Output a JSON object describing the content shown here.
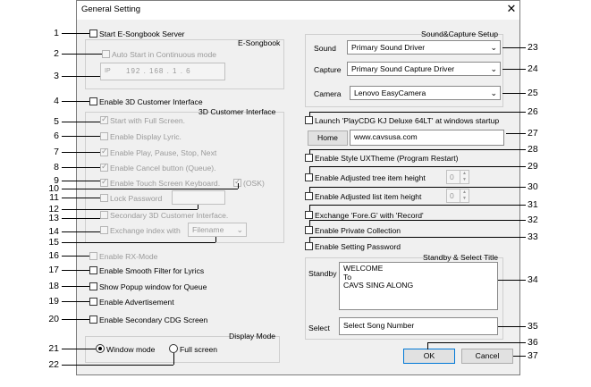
{
  "window": {
    "title": "General Setting",
    "close_glyph": "✕"
  },
  "callouts": [
    "1",
    "2",
    "3",
    "4",
    "5",
    "6",
    "7",
    "8",
    "9",
    "10",
    "11",
    "12",
    "13",
    "14",
    "15",
    "16",
    "17",
    "18",
    "19",
    "20",
    "21",
    "22",
    "23",
    "24",
    "25",
    "26",
    "27",
    "28",
    "29",
    "30",
    "31",
    "32",
    "33",
    "34",
    "35",
    "36",
    "37"
  ],
  "esongbook": {
    "group_title": "E-Songbook",
    "start_server": {
      "label": "Start E-Songbook Server",
      "checked": false
    },
    "auto_start": {
      "label": "Auto Start in Continuous mode",
      "checked": false
    },
    "ip_prefix": "IP",
    "ip_value": "192 . 168 . 1 . 6"
  },
  "enable3d": {
    "label": "Enable 3D Customer Interface",
    "checked": false
  },
  "customer3d": {
    "group_title": "3D Customer Interface",
    "full_screen": {
      "label": "Start with Full Screen.",
      "checked": true
    },
    "display_lyric": {
      "label": "Enable Display Lyric.",
      "checked": false
    },
    "play_pause": {
      "label": "Enable Play, Pause, Stop, Next",
      "checked": true
    },
    "cancel_button": {
      "label": "Enable Cancel button (Queue).",
      "checked": true
    },
    "touch_keyboard": {
      "label": "Enable Touch Screen Keyboard.",
      "checked": true
    },
    "osk": {
      "label": "(OSK)",
      "checked": true
    },
    "lock_password": {
      "label": "Lock Password",
      "checked": false
    },
    "secondary_3d": {
      "label": "Secondary 3D Customer Interface.",
      "checked": false
    },
    "exchange_index": {
      "label": "Exchange index with",
      "checked": false,
      "value": "Filename"
    }
  },
  "left_options": {
    "rx_mode": {
      "label": "Enable RX-Mode",
      "checked": false
    },
    "smooth_filter": {
      "label": "Enable Smooth Filter for Lyrics",
      "checked": false
    },
    "popup_queue": {
      "label": "Show Popup window for Queue",
      "checked": false
    },
    "advertisement": {
      "label": "Enable Advertisement",
      "checked": false
    },
    "secondary_cdg": {
      "label": "Enable Secondary CDG Screen",
      "checked": false
    }
  },
  "display_mode": {
    "group_title": "Display Mode",
    "window_mode": {
      "label": "Window mode",
      "selected": true
    },
    "full_screen": {
      "label": "Full screen",
      "selected": false
    }
  },
  "sound_capture": {
    "group_title": "Sound&Capture Setup",
    "sound": {
      "label": "Sound",
      "value": "Primary Sound Driver"
    },
    "capture": {
      "label": "Capture",
      "value": "Primary Sound Capture Driver"
    },
    "camera": {
      "label": "Camera",
      "value": "Lenovo EasyCamera"
    }
  },
  "right_options": {
    "launch_startup": {
      "label": "Launch 'PlayCDG KJ Deluxe 64LT' at windows startup",
      "checked": false
    },
    "home_button": "Home",
    "home_url": "www.cavsusa.com",
    "style_uxtheme": {
      "label": "Enable Style UXTheme (Program Restart)",
      "checked": false
    },
    "adjust_tree": {
      "label": "Enable Adjusted tree item height",
      "checked": false,
      "value": "0"
    },
    "adjust_list": {
      "label": "Enable Adjusted list item height",
      "checked": false,
      "value": "0"
    },
    "exchange_fore": {
      "label": "Exchange 'Fore.G' with 'Record'",
      "checked": false
    },
    "private_collection": {
      "label": "Enable Private Collection",
      "checked": false
    },
    "setting_password": {
      "label": "Enable Setting Password",
      "checked": false
    }
  },
  "standby_select": {
    "group_title": "Standby & Select Title",
    "standby_label": "Standby",
    "standby_lines": [
      "WELCOME",
      "To",
      "CAVS SING ALONG"
    ],
    "select_label": "Select",
    "select_value": "Select Song Number"
  },
  "buttons": {
    "ok": "OK",
    "cancel": "Cancel"
  }
}
